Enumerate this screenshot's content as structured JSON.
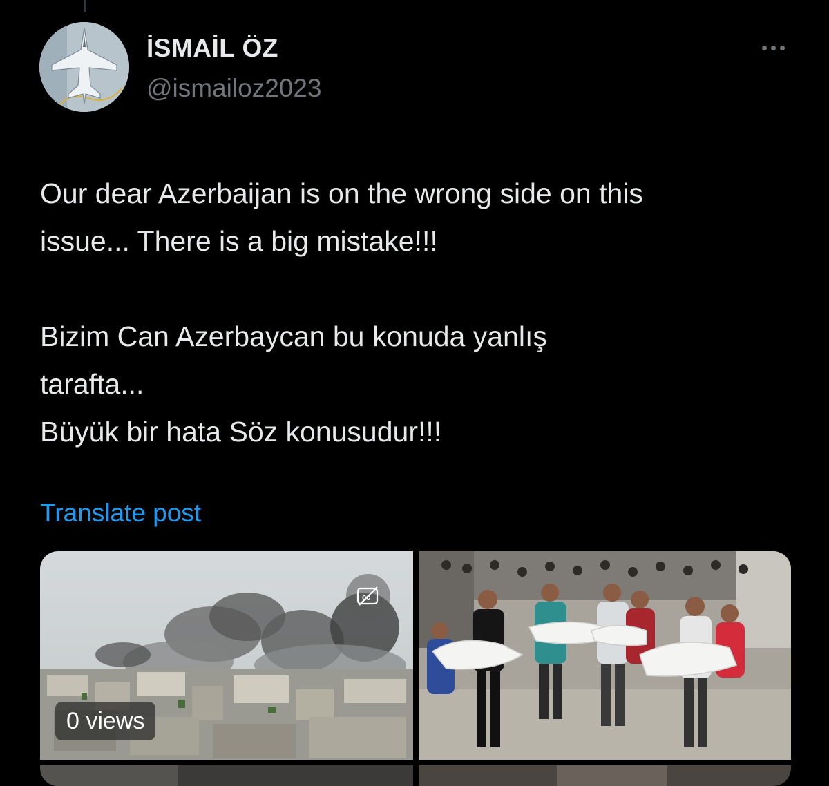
{
  "post": {
    "author": {
      "display_name": "İSMAİL ÖZ",
      "handle": "@ismailoz2023",
      "avatar_icon": "fighter-jet-avatar"
    },
    "more_icon": "more-horizontal-icon",
    "text": "Our dear Azerbaijan is on the wrong side on this\nissue... There is a big mistake!!!\n\nBizim Can Azerbaycan bu konuda yanlış\ntarafta...\nBüyük bir hata Söz konusudur!!!",
    "translate_label": "Translate post",
    "media": {
      "video": {
        "views_label": "0 views",
        "captions_icon": "captions-off-icon"
      }
    }
  },
  "colors": {
    "background": "#000000",
    "text": "#e7e9ea",
    "secondary_text": "#71767b",
    "link": "#1d9bf0"
  }
}
